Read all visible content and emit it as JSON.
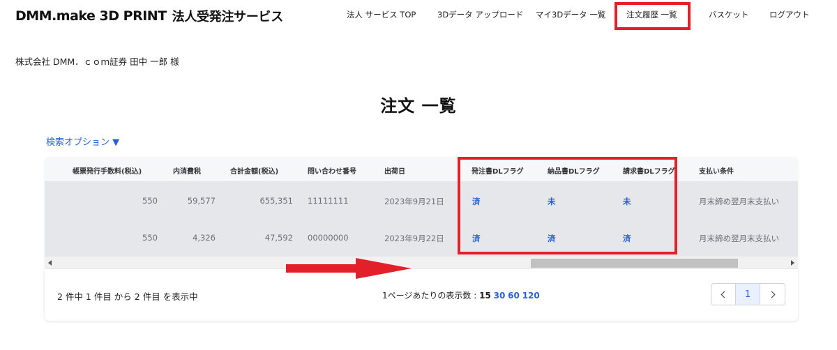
{
  "header": {
    "brand": "DMM.make 3D PRINT",
    "service": "法人受発注サービス",
    "nav": [
      {
        "label": "法人 サービス TOP"
      },
      {
        "label": "3Dデータ アップロード"
      },
      {
        "label": "マイ3Dデータ 一覧"
      },
      {
        "label": "注文履歴 一覧"
      },
      {
        "label": "バスケット"
      },
      {
        "label": "ログアウト"
      }
    ]
  },
  "user": {
    "company_line": "株式会社 DMM．ｃｏｍ証券 田中 一郎 様"
  },
  "page": {
    "title": "注文 一覧",
    "search_options": "検索オプション ▼"
  },
  "table": {
    "columns": [
      "帳票発行手数料(税込)",
      "内消費税",
      "合計金額(税込)",
      "問い合わせ番号",
      "出荷日",
      "発注書DLフラグ",
      "納品書DLフラグ",
      "請求書DLフラグ",
      "支払い条件"
    ],
    "rows": [
      {
        "fee": "550",
        "tax": "59,577",
        "total": "655,351",
        "inquiry": "11111111",
        "ship_date": "2023年9月21日",
        "po_flag": "済",
        "delivery_flag": "未",
        "invoice_flag": "未",
        "payment": "月末締め翌月末支払い"
      },
      {
        "fee": "550",
        "tax": "4,326",
        "total": "47,592",
        "inquiry": "00000000",
        "ship_date": "2023年9月22日",
        "po_flag": "済",
        "delivery_flag": "済",
        "invoice_flag": "済",
        "payment": "月末締め翌月末支払い"
      }
    ]
  },
  "pager": {
    "summary": "2 件中 1 件目 から 2 件目 を表示中",
    "per_page_label": "1ページあたりの表示数 :",
    "per_page_current": "15",
    "per_page_options": [
      "30",
      "60",
      "120"
    ],
    "current_page": "1"
  },
  "icons": {
    "prev": "chevron-left-icon",
    "next": "chevron-right-icon",
    "annotation_arrow": "red-arrow-right-icon"
  },
  "colors": {
    "link": "#2560d8",
    "annotation": "#e3202a",
    "row_bg": "#e6e7ea"
  }
}
